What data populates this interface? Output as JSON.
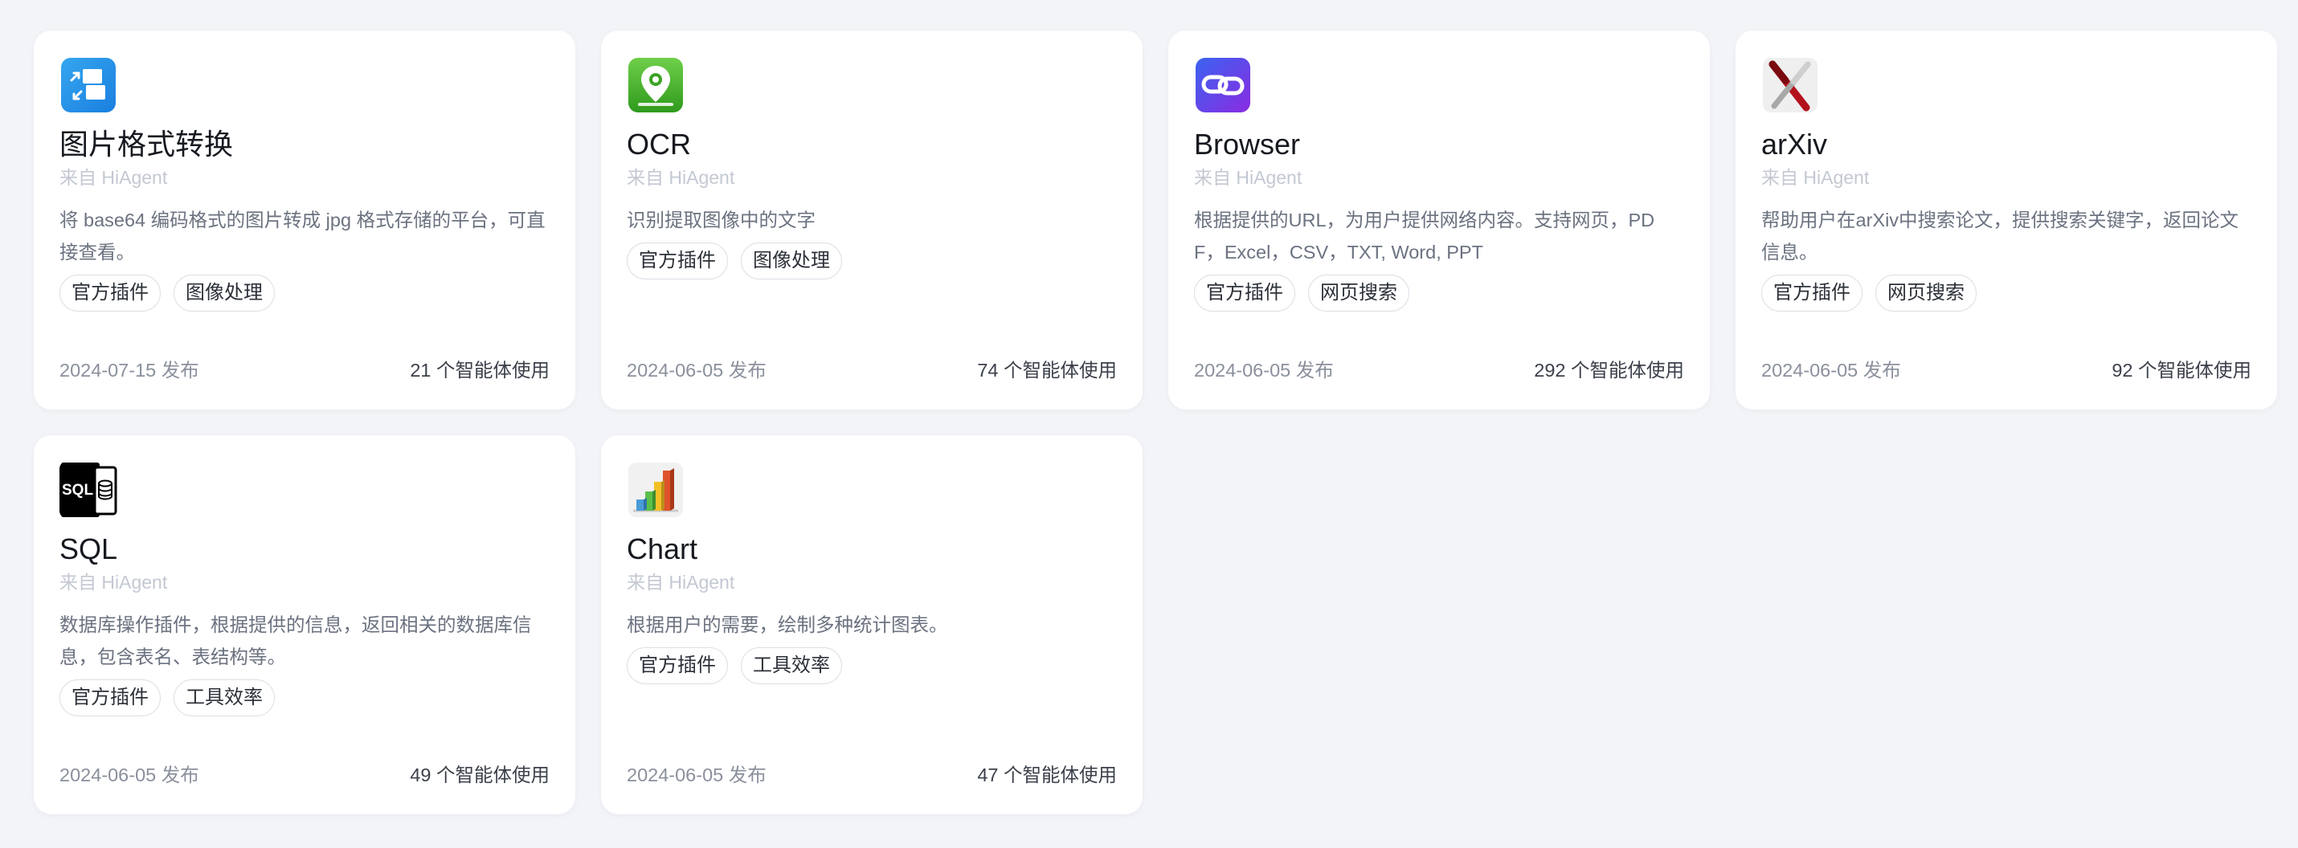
{
  "cards": [
    {
      "icon": "image-convert-icon",
      "title": "图片格式转换",
      "source": "来自 HiAgent",
      "description": "将 base64 编码格式的图片转成 jpg 格式存储的平台，可直接查看。",
      "tags": [
        "官方插件",
        "图像处理"
      ],
      "date": "2024-07-15 发布",
      "usage": "21 个智能体使用"
    },
    {
      "icon": "ocr-pin-icon",
      "title": "OCR",
      "source": "来自 HiAgent",
      "description": "识别提取图像中的文字",
      "tags": [
        "官方插件",
        "图像处理"
      ],
      "date": "2024-06-05 发布",
      "usage": "74 个智能体使用"
    },
    {
      "icon": "link-icon",
      "title": "Browser",
      "source": "来自 HiAgent",
      "description": "根据提供的URL，为用户提供网络内容。支持网页，PDF，Excel，CSV，TXT, Word, PPT",
      "tags": [
        "官方插件",
        "网页搜索"
      ],
      "date": "2024-06-05 发布",
      "usage": "292 个智能体使用"
    },
    {
      "icon": "arxiv-x-icon",
      "title": "arXiv",
      "source": "来自 HiAgent",
      "description": "帮助用户在arXiv中搜索论文，提供搜索关键字，返回论文信息。",
      "tags": [
        "官方插件",
        "网页搜索"
      ],
      "date": "2024-06-05 发布",
      "usage": "92 个智能体使用"
    },
    {
      "icon": "sql-database-icon",
      "title": "SQL",
      "source": "来自 HiAgent",
      "description": "数据库操作插件，根据提供的信息，返回相关的数据库信息，包含表名、表结构等。",
      "tags": [
        "官方插件",
        "工具效率"
      ],
      "date": "2024-06-05 发布",
      "usage": "49 个智能体使用"
    },
    {
      "icon": "bar-chart-icon",
      "title": "Chart",
      "source": "来自 HiAgent",
      "description": "根据用户的需要，绘制多种统计图表。",
      "tags": [
        "官方插件",
        "工具效率"
      ],
      "date": "2024-06-05 发布",
      "usage": "47 个智能体使用"
    }
  ]
}
